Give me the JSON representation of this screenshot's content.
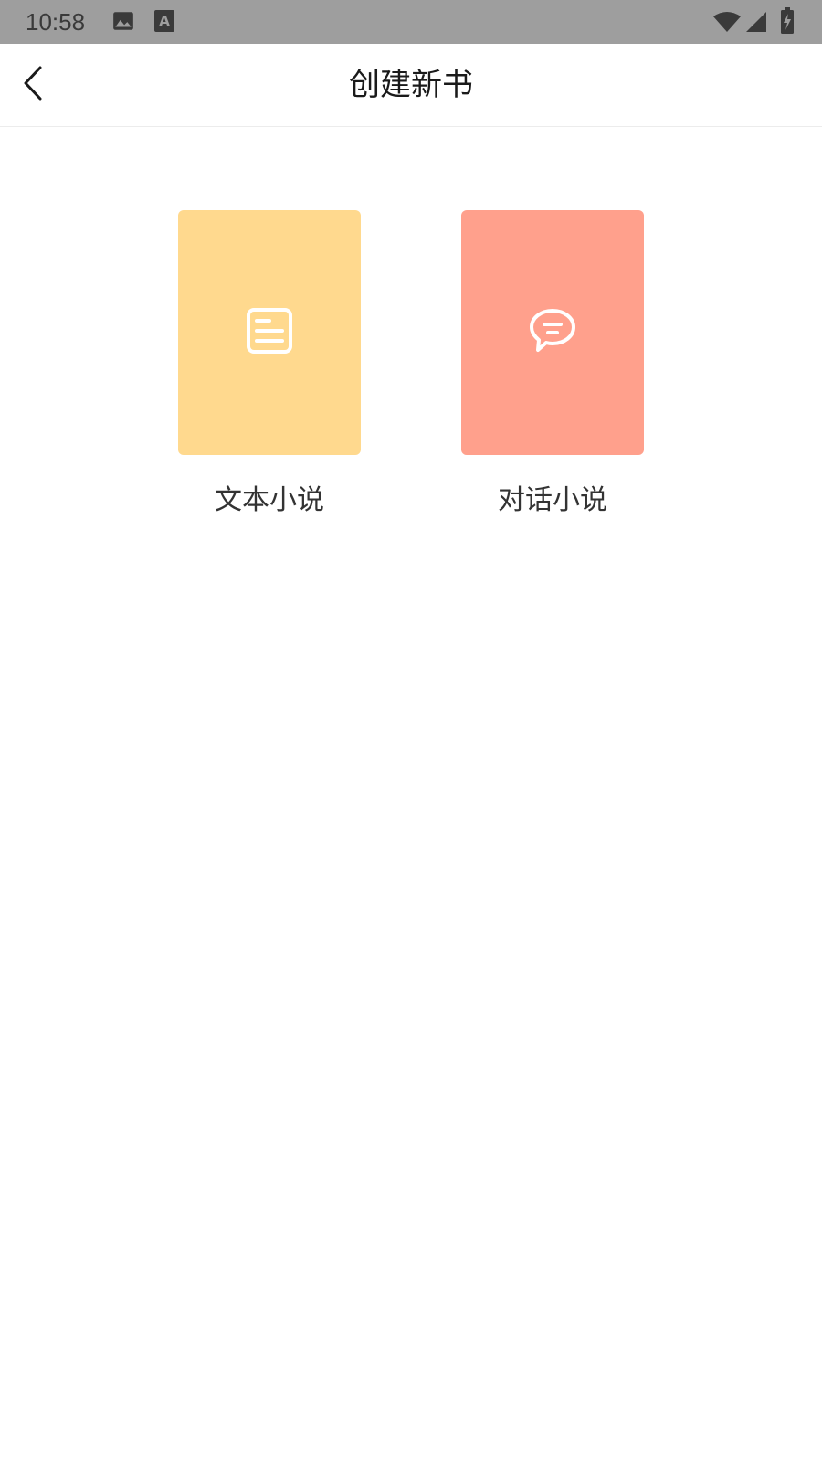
{
  "status_bar": {
    "time": "10:58",
    "icons": [
      "image-icon",
      "font-a-icon",
      "wifi-icon",
      "signal-icon",
      "battery-charging-icon"
    ]
  },
  "header": {
    "title": "创建新书",
    "back_icon": "chevron-left-icon"
  },
  "options": [
    {
      "label": "文本小说",
      "icon": "document-lines-icon",
      "color": "#FFD98E"
    },
    {
      "label": "对话小说",
      "icon": "chat-bubble-icon",
      "color": "#FFA08C"
    }
  ]
}
